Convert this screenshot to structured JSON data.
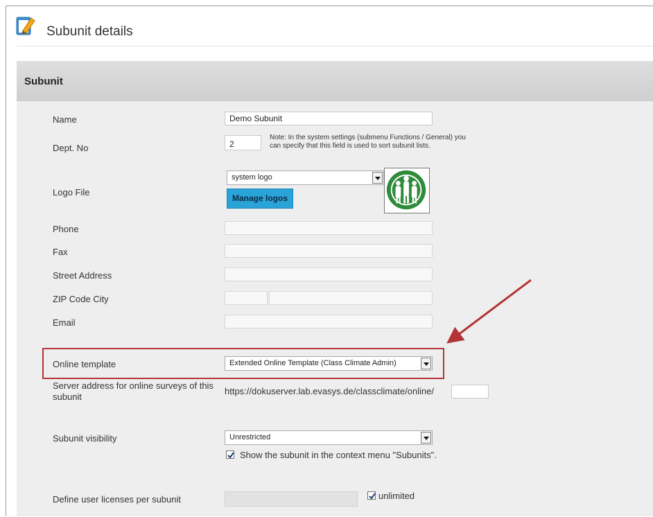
{
  "page": {
    "title": "Subunit details"
  },
  "panel": {
    "title": "Subunit"
  },
  "fields": {
    "name": {
      "label": "Name",
      "value": "Demo Subunit"
    },
    "dept_no": {
      "label": "Dept. No",
      "value": "2",
      "note": "Note: In the system settings (submenu Functions / General) you can specify that this field is used to sort subunit lists."
    },
    "logo_file": {
      "label": "Logo File",
      "selected": "system logo",
      "manage_button": "Manage logos"
    },
    "phone": {
      "label": "Phone",
      "value": ""
    },
    "fax": {
      "label": "Fax",
      "value": ""
    },
    "street": {
      "label": "Street Address",
      "value": ""
    },
    "zip_city": {
      "label": "ZIP Code City",
      "zip": "",
      "city": ""
    },
    "email": {
      "label": "Email",
      "value": ""
    },
    "online_template": {
      "label": "Online template",
      "selected": "Extended Online Template (Class Climate Admin)"
    },
    "server_address": {
      "label": "Server address for online surveys of this subunit",
      "url": "https://dokuserver.lab.evasys.de/classclimate/online/",
      "suffix": ""
    },
    "visibility": {
      "label": "Subunit visibility",
      "selected": "Unrestricted",
      "context_menu_checkbox": {
        "label": "Show the subunit in the context menu \"Subunits\".",
        "checked": true
      }
    },
    "licenses": {
      "label": "Define user licenses per subunit",
      "value": "",
      "unlimited": {
        "label": "unlimited",
        "checked": true
      }
    }
  },
  "colors": {
    "highlight": "#b23338",
    "button": "#2aa3d8",
    "panel_bg": "#eeeeee"
  },
  "icons": {
    "title": "edit-document-icon"
  }
}
